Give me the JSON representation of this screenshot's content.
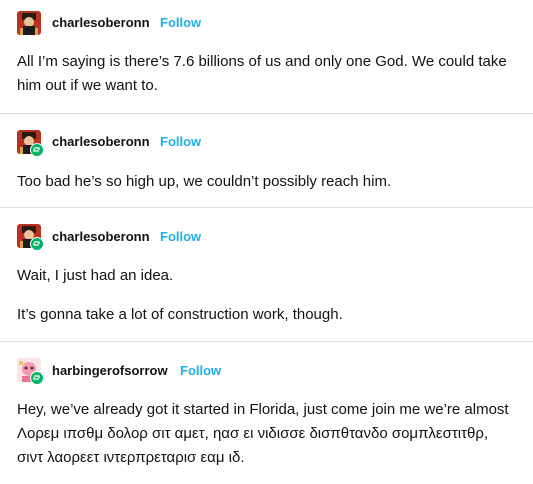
{
  "posts": [
    {
      "username": "charlesoberonn",
      "follow_label": "Follow",
      "paragraphs": [
        "All I’m saying is there’s 7.6 billions of us and only one God. We could take him out if we want to."
      ]
    },
    {
      "username": "charlesoberonn",
      "follow_label": "Follow",
      "paragraphs": [
        "Too bad he’s so high up, we couldn’t possibly reach him."
      ]
    },
    {
      "username": "charlesoberonn",
      "follow_label": "Follow",
      "paragraphs": [
        "Wait, I just had an idea.",
        "It’s gonna take a lot of construction work, though."
      ]
    },
    {
      "username": "harbingerofsorrow",
      "follow_label": "Follow",
      "paragraphs": [
        "Hey, we’ve already got it started in Florida, just come join me we’re almost Λορεμ ιπσθμ δολορ σιτ αμετ, ηασ ει νιδισσε δισπθτανδο σομπλεστιτθρ, σιντ λαορεετ ιντερπρεταρισ εαμ ιδ."
      ]
    }
  ],
  "colors": {
    "follow": "#1eb1ee",
    "reblog_badge": "#00b464",
    "divider": "#dedede"
  },
  "icons": {
    "avatar_1": "avatar-charlesoberonn",
    "avatar_2": "avatar-harbingerofsorrow",
    "reblog": "reblog-icon"
  }
}
